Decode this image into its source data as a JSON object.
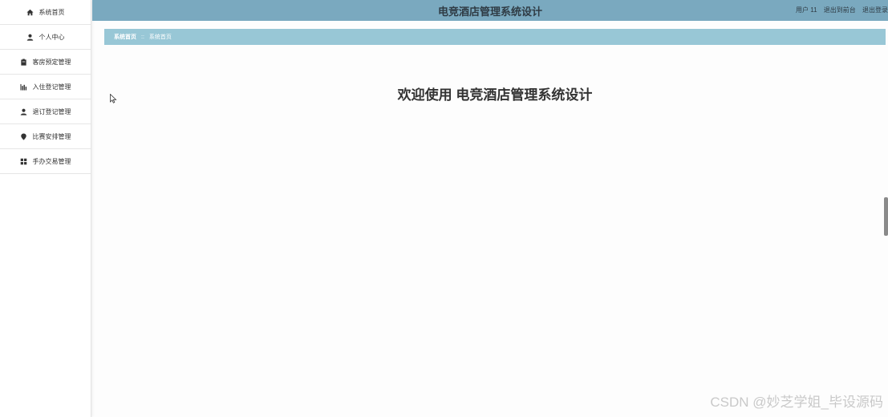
{
  "sidebar": {
    "items": [
      {
        "label": "系统首页",
        "icon": "home-icon"
      },
      {
        "label": "个人中心",
        "icon": "user-icon"
      },
      {
        "label": "客房预定管理",
        "icon": "clipboard-icon"
      },
      {
        "label": "入住登记管理",
        "icon": "bar-chart-icon"
      },
      {
        "label": "退订登记管理",
        "icon": "user-icon"
      },
      {
        "label": "比赛安排管理",
        "icon": "location-pin-icon"
      },
      {
        "label": "手办交易管理",
        "icon": "grid-icon"
      }
    ]
  },
  "header": {
    "title": "电竞酒店管理系统设计",
    "user_label": "用户 11",
    "front_link": "退出到前台",
    "logout_link": "退出登录"
  },
  "breadcrumb": {
    "items": [
      "系统首页",
      "系统首页"
    ],
    "separator": "::"
  },
  "main": {
    "welcome": "欢迎使用 电竞酒店管理系统设计"
  },
  "watermark": "CSDN @妙芝学姐_毕设源码",
  "colors": {
    "header_bg": "#7aa9bf",
    "breadcrumb_bg": "#98c7d6"
  }
}
